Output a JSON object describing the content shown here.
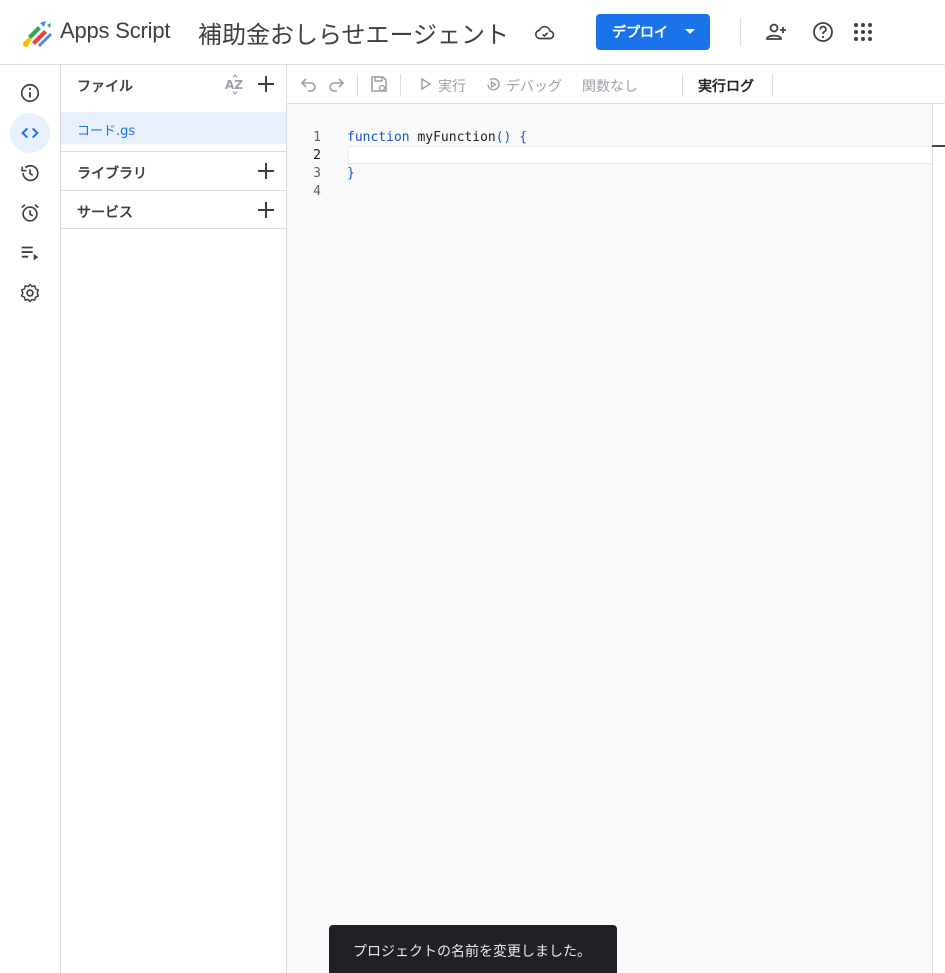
{
  "header": {
    "app_name": "Apps Script",
    "project_title": "補助金おしらせエージェント",
    "deploy_label": "デプロイ",
    "icons": [
      "apps-script-logo-icon",
      "cloud-saved-icon",
      "add-person-icon",
      "help-icon",
      "apps-grid-icon"
    ]
  },
  "rail": {
    "items": [
      {
        "name": "overview",
        "icon": "info-icon"
      },
      {
        "name": "editor",
        "icon": "code-icon",
        "active": true
      },
      {
        "name": "history",
        "icon": "history-icon"
      },
      {
        "name": "triggers",
        "icon": "alarm-icon"
      },
      {
        "name": "executions",
        "icon": "playlist-icon"
      },
      {
        "name": "settings",
        "icon": "gear-icon"
      }
    ]
  },
  "files": {
    "title": "ファイル",
    "items": [
      {
        "name": "コード.gs",
        "selected": true
      }
    ],
    "libraries_label": "ライブラリ",
    "services_label": "サービス"
  },
  "toolbar": {
    "run_label": "実行",
    "debug_label": "デバッグ",
    "function_select": "関数なし",
    "log_label": "実行ログ"
  },
  "editor": {
    "current_line": 2,
    "lines": [
      {
        "num": "1",
        "code_kw": "function",
        "code_fn": " myFunction",
        "code_pn": "() {"
      },
      {
        "num": "2",
        "code_kw": "",
        "code_fn": "",
        "code_pn": ""
      },
      {
        "num": "3",
        "code_kw": "",
        "code_fn": "",
        "code_pn": "}"
      },
      {
        "num": "4",
        "code_kw": "",
        "code_fn": "",
        "code_pn": ""
      }
    ]
  },
  "toast": {
    "message": "プロジェクトの名前を変更しました。"
  },
  "colors": {
    "accent": "#1a73e8",
    "active_bg": "#e8f0fe",
    "toast_bg": "#202124",
    "keyword": "#1a56c4"
  }
}
